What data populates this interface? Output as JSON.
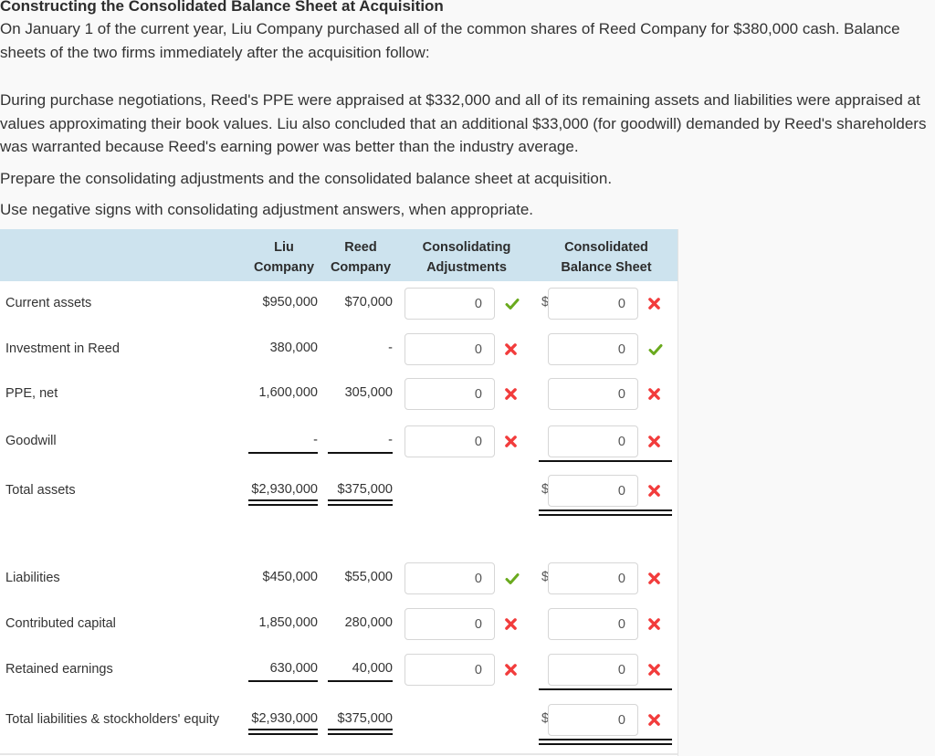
{
  "page": {
    "title": "Constructing the Consolidated Balance Sheet at Acquisition",
    "paragraphs": [
      "On January 1 of the current year, Liu Company purchased all of the common shares of Reed Company for $380,000 cash. Balance sheets of the two firms immediately after the acquisition follow:",
      "During purchase negotiations, Reed's PPE were appraised at $332,000 and all of its remaining assets and liabilities were appraised at values approximating their book values. Liu also concluded that an additional $33,000 (for goodwill) demanded by Reed's shareholders was warranted because Reed's earning power was better than the industry average.",
      "Prepare the consolidating adjustments and the consolidated balance sheet at acquisition.",
      "Use negative signs with consolidating adjustment answers, when appropriate."
    ]
  },
  "table": {
    "headers": {
      "liu": "Liu Company",
      "reed": "Reed Company",
      "adjustments": "Consolidating Adjustments",
      "consolidated": "Consolidated Balance Sheet"
    },
    "currency_symbol": "$",
    "rows": [
      {
        "label": "Current assets",
        "liu": "$950,000",
        "reed": "$70,000",
        "adjustment": "0",
        "adjustment_status": "correct",
        "consolidated": "0",
        "consolidated_status": "incorrect"
      },
      {
        "label": "Investment in Reed",
        "liu": "380,000",
        "reed": "-",
        "adjustment": "0",
        "adjustment_status": "incorrect",
        "consolidated": "0",
        "consolidated_status": "correct"
      },
      {
        "label": "PPE, net",
        "liu": "1,600,000",
        "reed": "305,000",
        "adjustment": "0",
        "adjustment_status": "incorrect",
        "consolidated": "0",
        "consolidated_status": "incorrect"
      },
      {
        "label": "Goodwill",
        "liu": "-",
        "reed": "-",
        "adjustment": "0",
        "adjustment_status": "incorrect",
        "consolidated": "0",
        "consolidated_status": "incorrect"
      },
      {
        "label": "Total assets",
        "liu": "$2,930,000",
        "reed": "$375,000",
        "consolidated": "0",
        "consolidated_status": "incorrect"
      },
      {
        "label": "Liabilities",
        "liu": "$450,000",
        "reed": "$55,000",
        "adjustment": "0",
        "adjustment_status": "correct",
        "consolidated": "0",
        "consolidated_status": "incorrect"
      },
      {
        "label": "Contributed capital",
        "liu": "1,850,000",
        "reed": "280,000",
        "adjustment": "0",
        "adjustment_status": "incorrect",
        "consolidated": "0",
        "consolidated_status": "incorrect"
      },
      {
        "label": "Retained earnings",
        "liu": "630,000",
        "reed": "40,000",
        "adjustment": "0",
        "adjustment_status": "incorrect",
        "consolidated": "0",
        "consolidated_status": "incorrect"
      },
      {
        "label": "Total liabilities & stockholders' equity",
        "liu": "$2,930,000",
        "reed": "$375,000",
        "consolidated": "0",
        "consolidated_status": "incorrect"
      }
    ],
    "status_colors": {
      "correct": "#6aaa1e",
      "incorrect": "#f23c3c"
    }
  }
}
